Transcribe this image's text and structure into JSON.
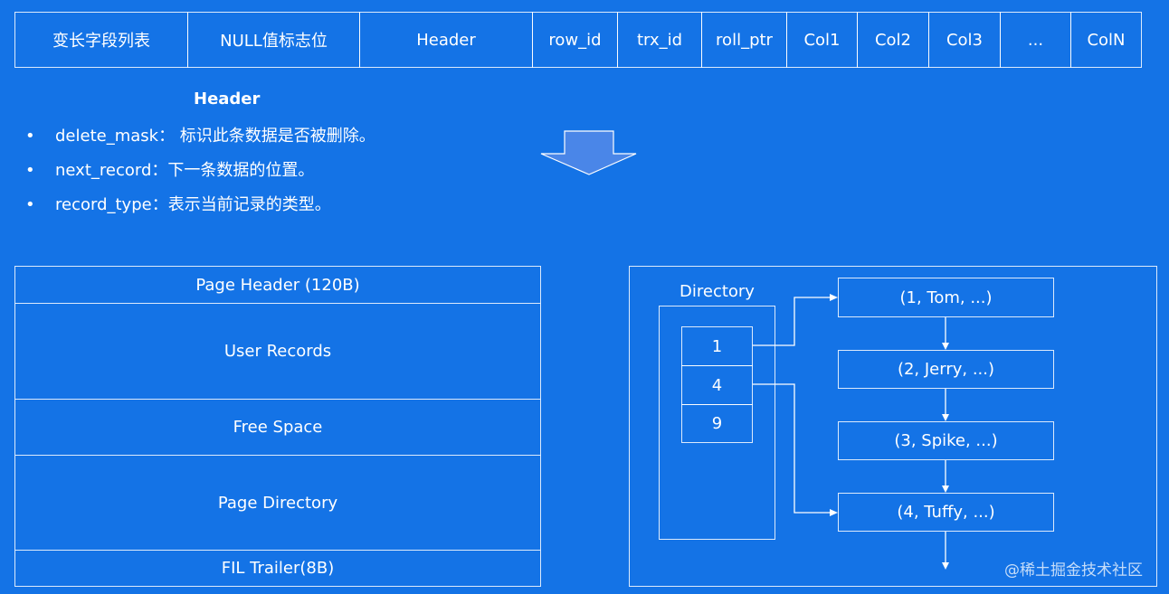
{
  "record_format": {
    "cells": [
      "变长字段列表",
      "NULL值标志位",
      "Header",
      "row_id",
      "trx_id",
      "roll_ptr",
      "Col1",
      "Col2",
      "Col3",
      "...",
      "ColN"
    ]
  },
  "header_info": {
    "title": "Header",
    "bullets": [
      "delete_mask： 标识此条数据是否被删除。",
      "next_record：下一条数据的位置。",
      "record_type：表示当前记录的类型。"
    ]
  },
  "page_layout": {
    "rows": [
      "Page Header (120B)",
      "User Records",
      "Free Space",
      "Page Directory",
      "FIL Trailer(8B)"
    ]
  },
  "directory": {
    "label": "Directory",
    "slots": [
      "1",
      "4",
      "9"
    ],
    "records": [
      "(1, Tom, ...)",
      "(2, Jerry, ...)",
      "(3, Spike, ...)",
      "(4, Tuffy, ...)"
    ]
  },
  "watermark": "@稀土掘金技术社区",
  "colors": {
    "background": "#1473e6",
    "line": "#ffffff",
    "arrow": "#4a86e8"
  }
}
